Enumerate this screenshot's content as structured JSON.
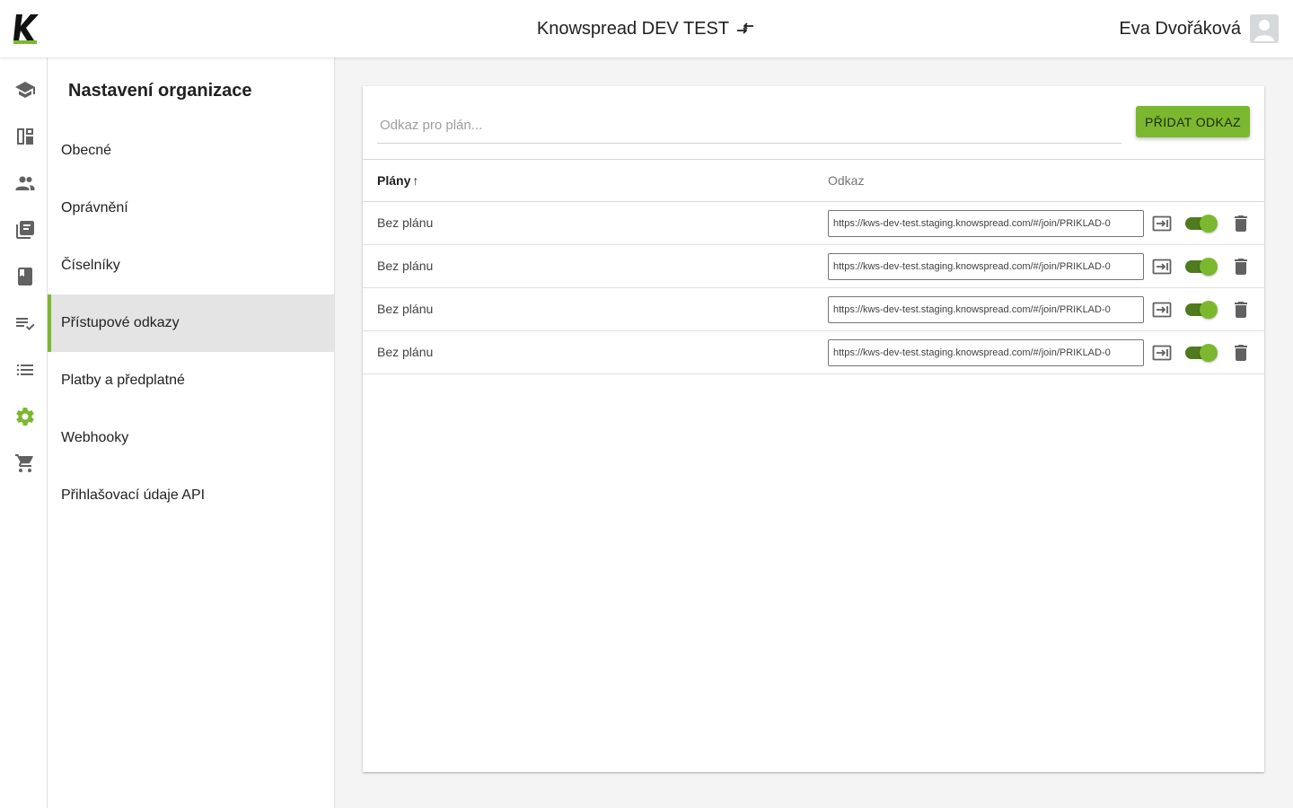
{
  "app": {
    "org_name": "Knowspread DEV TEST",
    "user_name": "Eva Dvořáková",
    "accent_color": "#7cb82f"
  },
  "rail": {
    "items": [
      {
        "icon": "school-icon"
      },
      {
        "icon": "dashboard-icon"
      },
      {
        "icon": "people-icon"
      },
      {
        "icon": "library-icon"
      },
      {
        "icon": "book-icon"
      },
      {
        "icon": "playlist-check-icon"
      },
      {
        "icon": "list-icon"
      },
      {
        "icon": "gear-icon",
        "active": true
      },
      {
        "icon": "cart-icon"
      }
    ]
  },
  "settings_menu": {
    "title": "Nastavení organizace",
    "items": [
      {
        "label": "Obecné"
      },
      {
        "label": "Oprávnění"
      },
      {
        "label": "Číselníky"
      },
      {
        "label": "Přístupové odkazy",
        "active": true
      },
      {
        "label": "Platby a předplatné"
      },
      {
        "label": "Webhooky"
      },
      {
        "label": "Přihlašovací údaje API"
      }
    ]
  },
  "access_links": {
    "input_placeholder": "Odkaz pro plán...",
    "input_value": "",
    "add_button_label": "PŘIDAT ODKAZ",
    "columns": {
      "plans": "Plány",
      "link": "Odkaz"
    },
    "sort_indicator": "↑",
    "rows": [
      {
        "plan": "Bez plánu",
        "url": "https://kws-dev-test.staging.knowspread.com/#/join/PRIKLAD-0",
        "enabled": true
      },
      {
        "plan": "Bez plánu",
        "url": "https://kws-dev-test.staging.knowspread.com/#/join/PRIKLAD-0",
        "enabled": true
      },
      {
        "plan": "Bez plánu",
        "url": "https://kws-dev-test.staging.knowspread.com/#/join/PRIKLAD-0",
        "enabled": true
      },
      {
        "plan": "Bez plánu",
        "url": "https://kws-dev-test.staging.knowspread.com/#/join/PRIKLAD-0",
        "enabled": true
      }
    ]
  }
}
